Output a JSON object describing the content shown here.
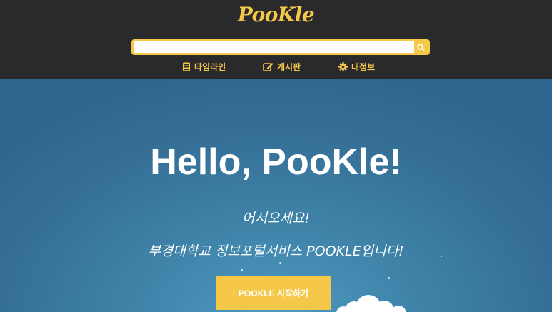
{
  "header": {
    "logo": "PooKle",
    "search": {
      "value": "",
      "placeholder": ""
    },
    "nav": [
      {
        "label": "타임라인",
        "icon": "book-icon"
      },
      {
        "label": "게시판",
        "icon": "edit-icon"
      },
      {
        "label": "내정보",
        "icon": "gear-icon"
      }
    ]
  },
  "hero": {
    "title": "Hello, PooKle!",
    "welcome": "어서오세요!",
    "intro": "부경대학교 정보포털서비스 POOKLE입니다!",
    "button_label": "POOKLE 시작하기"
  },
  "colors": {
    "accent": "#f6c84a",
    "header_bg": "#2a2a2c",
    "hero_bg": "#3f82a8"
  }
}
